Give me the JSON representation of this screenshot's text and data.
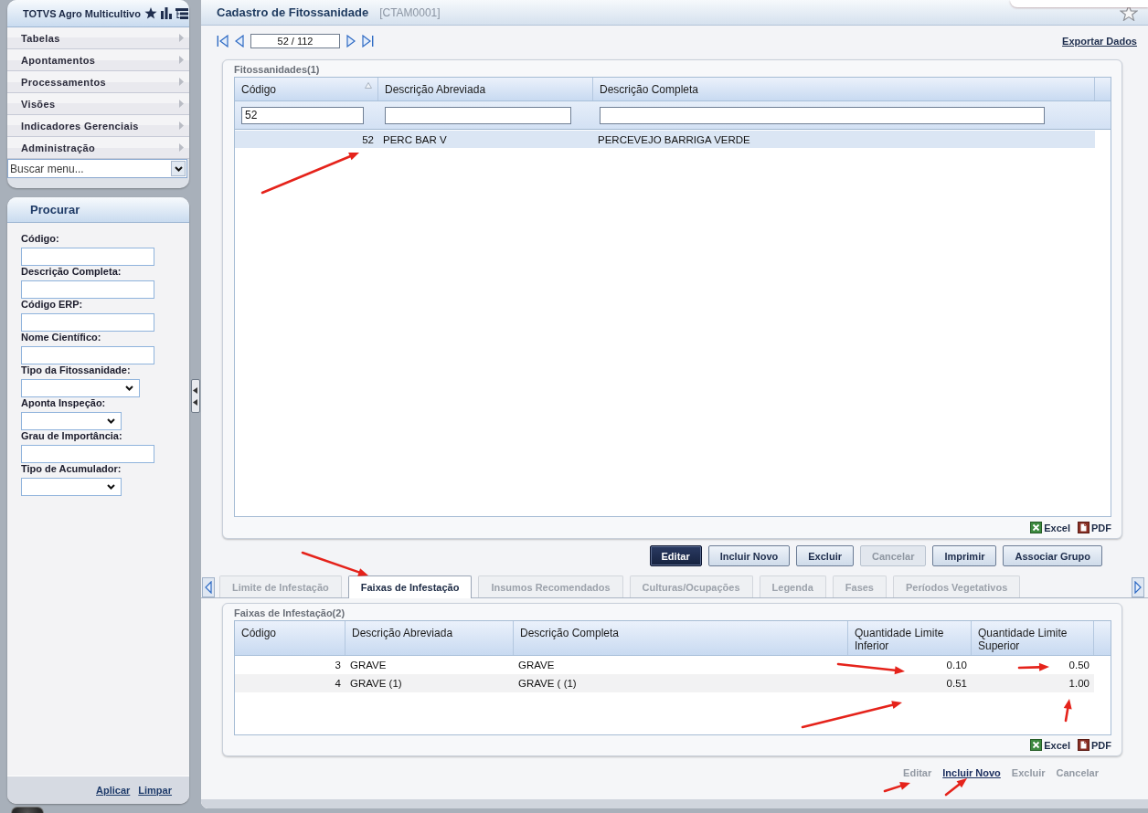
{
  "sidebar": {
    "title": "TOTVS Agro Multicultivo",
    "menu": [
      {
        "label": "Tabelas"
      },
      {
        "label": "Apontamentos"
      },
      {
        "label": "Processamentos"
      },
      {
        "label": "Visões"
      },
      {
        "label": "Indicadores Gerenciais"
      },
      {
        "label": "Administração"
      }
    ],
    "menu_search": {
      "placeholder": "Buscar menu..."
    }
  },
  "search_panel": {
    "title": "Procurar",
    "fields": [
      {
        "label": "Código:",
        "kind": "text"
      },
      {
        "label": "Descrição Completa:",
        "kind": "text"
      },
      {
        "label": "Código ERP:",
        "kind": "text"
      },
      {
        "label": "Nome Científico:",
        "kind": "text"
      },
      {
        "label": "Tipo da Fitossanidade:",
        "kind": "select"
      },
      {
        "label": "Aponta Inspeção:",
        "kind": "select"
      },
      {
        "label": "Grau de Importância:",
        "kind": "text"
      },
      {
        "label": "Tipo de Acumulador:",
        "kind": "select"
      }
    ],
    "actions": [
      "Aplicar",
      "Limpar"
    ]
  },
  "page": {
    "title": "Cadastro de Fitossanidade",
    "code": "[CTAM0001]",
    "pager": {
      "value": "52 / 112"
    },
    "export_link": "Exportar Dados"
  },
  "grid": {
    "caption": "Fitossanidades(1)",
    "columns": [
      {
        "label": "Código",
        "kind": "number",
        "sorted": true,
        "filter": "52"
      },
      {
        "label": "Descrição Abreviada",
        "kind": "text",
        "sorted": false
      },
      {
        "label": "Descrição Completa",
        "kind": "text",
        "sorted": false
      }
    ],
    "rows": [
      {
        "cells": [
          "52",
          "PERC BAR V",
          "PERCEVEJO BARRIGA VERDE"
        ],
        "selected": true
      }
    ],
    "exports": [
      {
        "label": "Excel",
        "kind": "excel"
      },
      {
        "label": "PDF",
        "kind": "pdf"
      }
    ]
  },
  "buttons": [
    {
      "label": "Editar",
      "focused": true,
      "disabled": false
    },
    {
      "label": "Incluir Novo",
      "focused": false,
      "disabled": false
    },
    {
      "label": "Excluir",
      "focused": false,
      "disabled": false
    },
    {
      "label": "Cancelar",
      "focused": false,
      "disabled": true
    },
    {
      "label": "Imprimir",
      "focused": false,
      "disabled": false
    },
    {
      "label": "Associar Grupo",
      "focused": false,
      "disabled": false
    }
  ],
  "tabs": [
    {
      "label": "Limite de Infestação",
      "selected": false
    },
    {
      "label": "Faixas de Infestação",
      "selected": true
    },
    {
      "label": "Insumos Recomendados",
      "selected": false
    },
    {
      "label": "Culturas/Ocupações",
      "selected": false
    },
    {
      "label": "Legenda",
      "selected": false
    },
    {
      "label": "Fases",
      "selected": false
    },
    {
      "label": "Períodos Vegetativos",
      "selected": false
    }
  ],
  "detail_grid": {
    "caption": "Faixas de Infestação(2)",
    "columns": [
      {
        "label": "Código",
        "kind": "number"
      },
      {
        "label": "Descrição Abreviada",
        "kind": "text"
      },
      {
        "label": "Descrição Completa",
        "kind": "text"
      },
      {
        "label": "Quantidade Limite Inferior",
        "kind": "number"
      },
      {
        "label": "Quantidade Limite Superior",
        "kind": "number"
      }
    ],
    "rows": [
      {
        "cells": [
          "3",
          "GRAVE",
          "GRAVE",
          "0.10",
          "0.50"
        ],
        "selected": false
      },
      {
        "cells": [
          "4",
          "GRAVE (1)",
          "GRAVE ( (1)",
          "0.51",
          "1.00"
        ],
        "selected": false
      }
    ],
    "exports": [
      {
        "label": "Excel",
        "kind": "excel"
      },
      {
        "label": "PDF",
        "kind": "pdf"
      }
    ]
  },
  "detail_actions": [
    {
      "label": "Editar",
      "disabled": true
    },
    {
      "label": "Incluir Novo",
      "disabled": false
    },
    {
      "label": "Excluir",
      "disabled": true
    },
    {
      "label": "Cancelar",
      "disabled": true
    }
  ]
}
